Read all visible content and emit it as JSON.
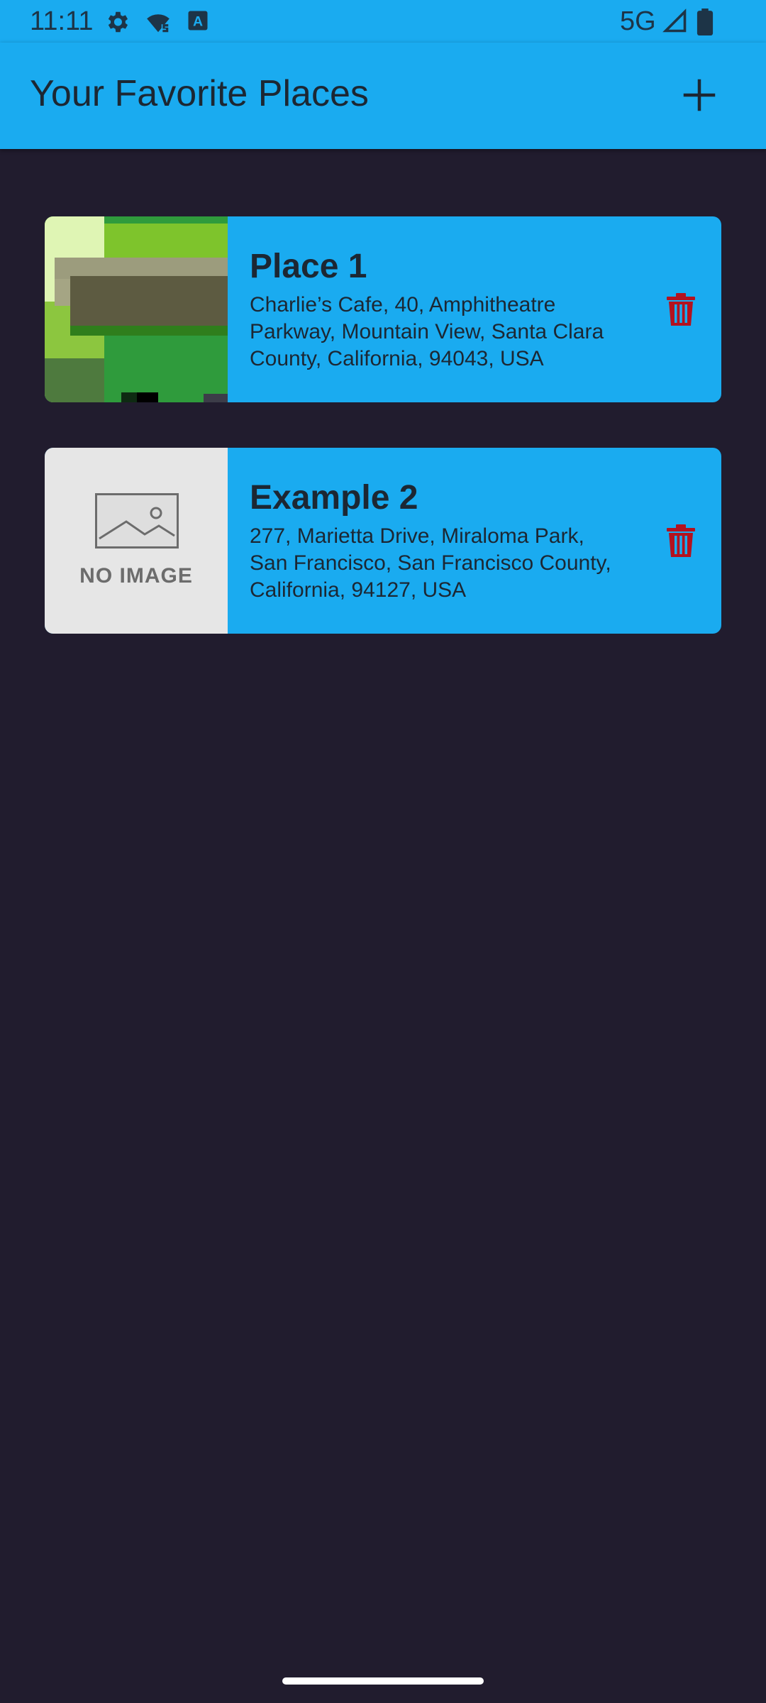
{
  "status_bar": {
    "time": "11:11",
    "network": "5G",
    "icons": [
      "settings-icon",
      "wifi-icon",
      "keyboard-icon",
      "signal-icon",
      "battery-icon"
    ]
  },
  "app_bar": {
    "title": "Your Favorite Places",
    "add_icon": "plus-icon"
  },
  "places": [
    {
      "title": "Place 1",
      "address": "Charlie’s Cafe, 40, Amphitheatre Parkway, Mountain View, Santa Clara County, California, 94043, USA",
      "image": "map-thumbnail"
    },
    {
      "title": "Example 2",
      "address": "277, Marietta Drive, Miraloma Park, San Francisco, San Francisco County, California, 94127, USA",
      "image": "no-image-placeholder",
      "no_image_text": "NO IMAGE"
    }
  ],
  "colors": {
    "app_bar": "#1aabf0",
    "background": "#211c2e",
    "card": "#1aabf0",
    "delete": "#b3121f"
  }
}
